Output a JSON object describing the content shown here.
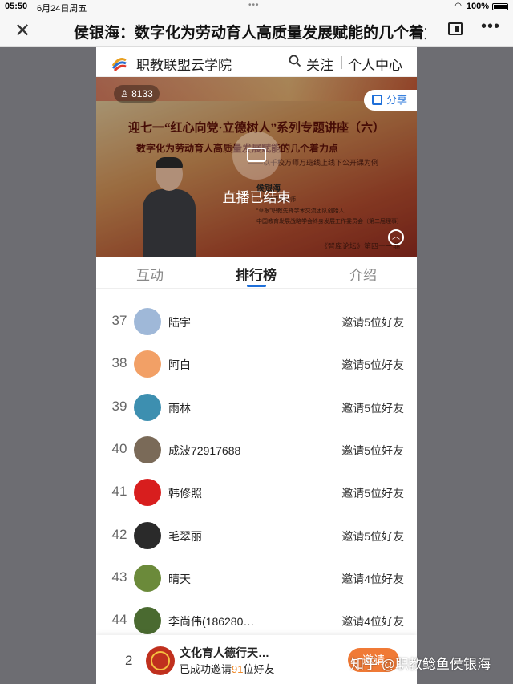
{
  "status_bar": {
    "time": "05:50",
    "date": "6月24日周五",
    "battery": "100%"
  },
  "nav": {
    "title": "侯银海：数字化为劳动育人高质量发展赋能的几个着力点"
  },
  "site": {
    "name": "职教联盟云学院",
    "follow": "关注",
    "personal_center": "个人中心"
  },
  "banner": {
    "viewers": "8133",
    "share_label": "分享",
    "title": "迎七一“红心向党·立德树人”系列专题讲座（六）",
    "subtitle": "数字化为劳动育人高质量发展赋能的几个着力点",
    "subtitle2": "——以千校万师万班线上线下公开课为例",
    "speaker": "侯银海",
    "lines": [
      "…学院高级技师",
      "“草根”职教先锋学术交流团队创始人",
      "中国教育发展战略学会终身发展工作委员会（第二届理事）"
    ],
    "footer": "《智库论坛》第四十一期",
    "live_status": "直播已结束"
  },
  "tabs": [
    {
      "label": "互动",
      "active": false
    },
    {
      "label": "排行榜",
      "active": true
    },
    {
      "label": "介绍",
      "active": false
    }
  ],
  "leaderboard": [
    {
      "rank": "37",
      "name": "陆宇",
      "invite": "邀请5位好友",
      "avatar_color": "#9fb8d8"
    },
    {
      "rank": "38",
      "name": "阿白",
      "invite": "邀请5位好友",
      "avatar_color": "#f2a066"
    },
    {
      "rank": "39",
      "name": "雨林",
      "invite": "邀请5位好友",
      "avatar_color": "#3d8fb0"
    },
    {
      "rank": "40",
      "name": "成波72917688",
      "invite": "邀请5位好友",
      "avatar_color": "#7a6a58"
    },
    {
      "rank": "41",
      "name": "韩修照",
      "invite": "邀请5位好友",
      "avatar_color": "#d81e1e"
    },
    {
      "rank": "42",
      "name": "毛翠丽",
      "invite": "邀请5位好友",
      "avatar_color": "#2a2a2a"
    },
    {
      "rank": "43",
      "name": "晴天",
      "invite": "邀请4位好友",
      "avatar_color": "#6b8a3a"
    },
    {
      "rank": "44",
      "name": "李尚伟(186280…",
      "invite": "邀请4位好友",
      "avatar_color": "#4a6a30"
    }
  ],
  "my_rank": {
    "rank": "2",
    "name": "文化育人德行天…",
    "status_prefix": "已成功邀请",
    "count": "91",
    "status_suffix": "位好友",
    "button": "邀请"
  },
  "watermark": "知乎 @职教鲶鱼侯银海",
  "colors": {
    "accent": "#1e6fd9",
    "invite_button": "#f07a36",
    "count_highlight": "#f08a2a"
  }
}
